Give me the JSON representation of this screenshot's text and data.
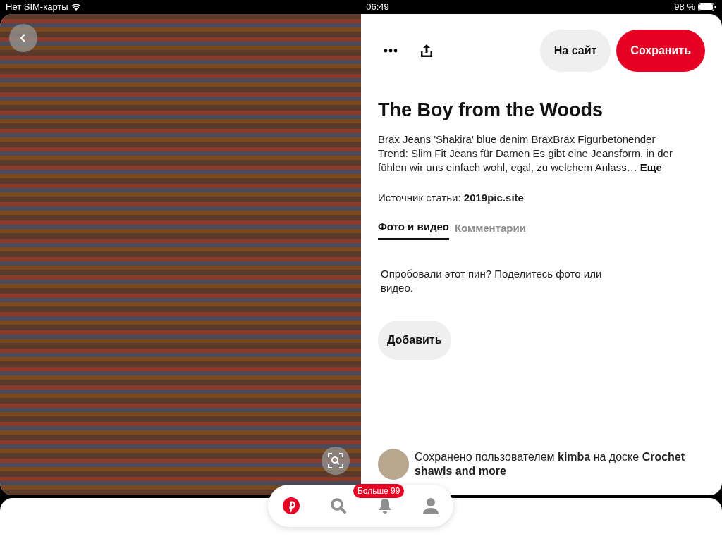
{
  "status_bar": {
    "carrier": "Нет SIM-карты",
    "time": "06:49",
    "battery": "98 %"
  },
  "pin": {
    "image": {
      "kind": "photo"
    },
    "actions": [
      {
        "kind": "more"
      },
      {
        "kind": "share"
      }
    ],
    "buttons": [
      {
        "label": "На сайт",
        "kind": "secondary"
      },
      {
        "label": "Сохранить",
        "kind": "primary"
      }
    ],
    "title": "The Boy from the Woods",
    "description": "Brax Jeans 'Shakira' blue denim BraxBrax Figurbetonender Trend: Slim Fit Jeans für Damen Es gibt eine Jeansform, in der fühlen wir uns einfach wohl, egal, zu welchem Anlass…",
    "more_link": "Еще",
    "source": "Источник статьи: **2019pic.site**",
    "tabs": [
      {
        "label": "Фото и видео",
        "selected": true
      },
      {
        "label": "Комментарии",
        "selected": false
      }
    ],
    "prompt": "Опробовали этот пин? Поделитесь фото или видео.",
    "add_button": "Добавить",
    "saved_by": "Сохранено пользователем **kimba** на доске **Crochet shawls and more**"
  },
  "bottom_nav": [
    {
      "kind": "home",
      "selected": true
    },
    {
      "kind": "search",
      "selected": false
    },
    {
      "kind": "notifications",
      "selected": false,
      "badge": "Больше 99"
    },
    {
      "kind": "profile",
      "selected": false
    }
  ]
}
